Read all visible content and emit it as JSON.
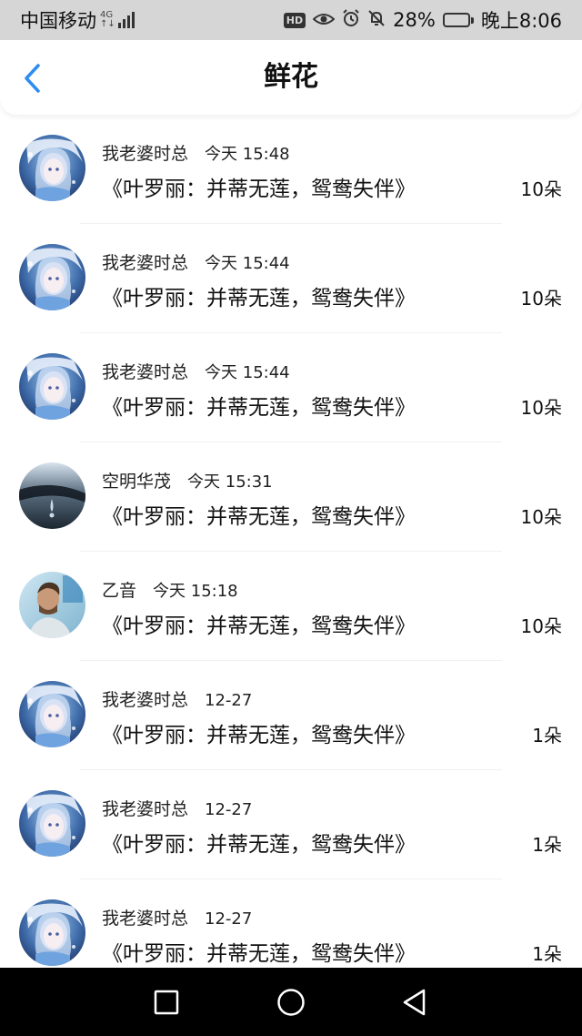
{
  "status_bar": {
    "carrier": "中国移动",
    "network_top": "4G",
    "network_bottom": "↑↓",
    "hd_label": "HD",
    "battery_percent": "28%",
    "battery_level": 0.28,
    "time": "晚上8:06",
    "icons": [
      "signal-icon",
      "eye-icon",
      "alarm-icon",
      "mute-bell-icon",
      "battery-icon"
    ]
  },
  "header": {
    "title": "鲜花",
    "back_icon": "chevron-left-icon",
    "accent_color": "#2f8cf0"
  },
  "records": [
    {
      "name": "我老婆时总",
      "time": "今天 15:48",
      "gift": "《叶罗丽：并蒂无莲，鸳鸯失伴》",
      "count": "10朵",
      "avatar": "anime-girl-avatar"
    },
    {
      "name": "我老婆时总",
      "time": "今天 15:44",
      "gift": "《叶罗丽：并蒂无莲，鸳鸯失伴》",
      "count": "10朵",
      "avatar": "anime-girl-avatar"
    },
    {
      "name": "我老婆时总",
      "time": "今天 15:44",
      "gift": "《叶罗丽：并蒂无莲，鸳鸯失伴》",
      "count": "10朵",
      "avatar": "anime-girl-avatar"
    },
    {
      "name": "空明华茂",
      "time": "今天 15:31",
      "gift": "《叶罗丽：并蒂无莲，鸳鸯失伴》",
      "count": "10朵",
      "avatar": "water-drop-avatar"
    },
    {
      "name": "乙音",
      "time": "今天 15:18",
      "gift": "《叶罗丽：并蒂无莲，鸳鸯失伴》",
      "count": "10朵",
      "avatar": "man-photo-avatar"
    },
    {
      "name": "我老婆时总",
      "time": "12-27",
      "gift": "《叶罗丽：并蒂无莲，鸳鸯失伴》",
      "count": "1朵",
      "avatar": "anime-girl-avatar"
    },
    {
      "name": "我老婆时总",
      "time": "12-27",
      "gift": "《叶罗丽：并蒂无莲，鸳鸯失伴》",
      "count": "1朵",
      "avatar": "anime-girl-avatar"
    },
    {
      "name": "我老婆时总",
      "time": "12-27",
      "gift": "《叶罗丽：并蒂无莲，鸳鸯失伴》",
      "count": "1朵",
      "avatar": "anime-girl-avatar"
    }
  ],
  "nav_bar": {
    "icons": [
      "recent-apps-icon",
      "home-icon",
      "back-triangle-icon"
    ]
  }
}
